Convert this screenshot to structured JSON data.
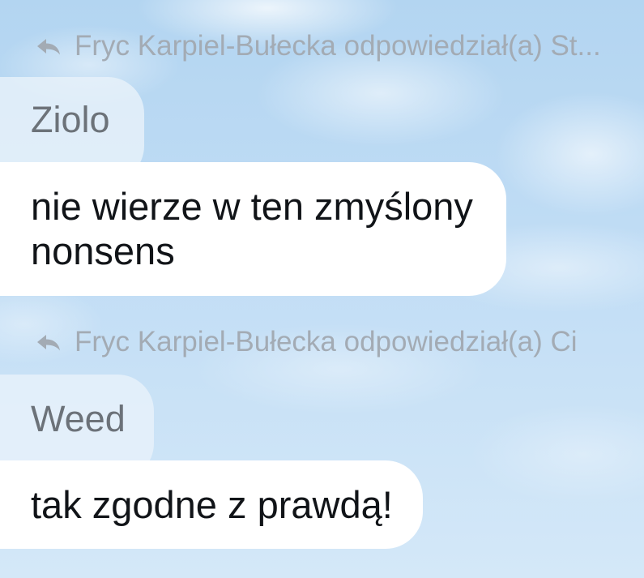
{
  "messages": [
    {
      "reply_header": "Fryc Karpiel-Bułecka odpowiedział(a) St...",
      "quoted_text": "Ziolo",
      "text": "nie wierze w ten zmyślony nonsens"
    },
    {
      "reply_header": "Fryc Karpiel-Bułecka odpowiedział(a) Ci",
      "quoted_text": "Weed",
      "text": "tak zgodne z prawdą!"
    }
  ],
  "icons": {
    "reply_indicator": "reply-arrow-icon"
  },
  "colors": {
    "background_top": "#b3d5f1",
    "background_bottom": "#d4e8f8",
    "message_bubble": "#ffffff",
    "quote_bubble": "#e8f1fa",
    "reply_header_text": "#a3abb4",
    "quote_text": "#6c7279",
    "message_text": "#111418"
  }
}
